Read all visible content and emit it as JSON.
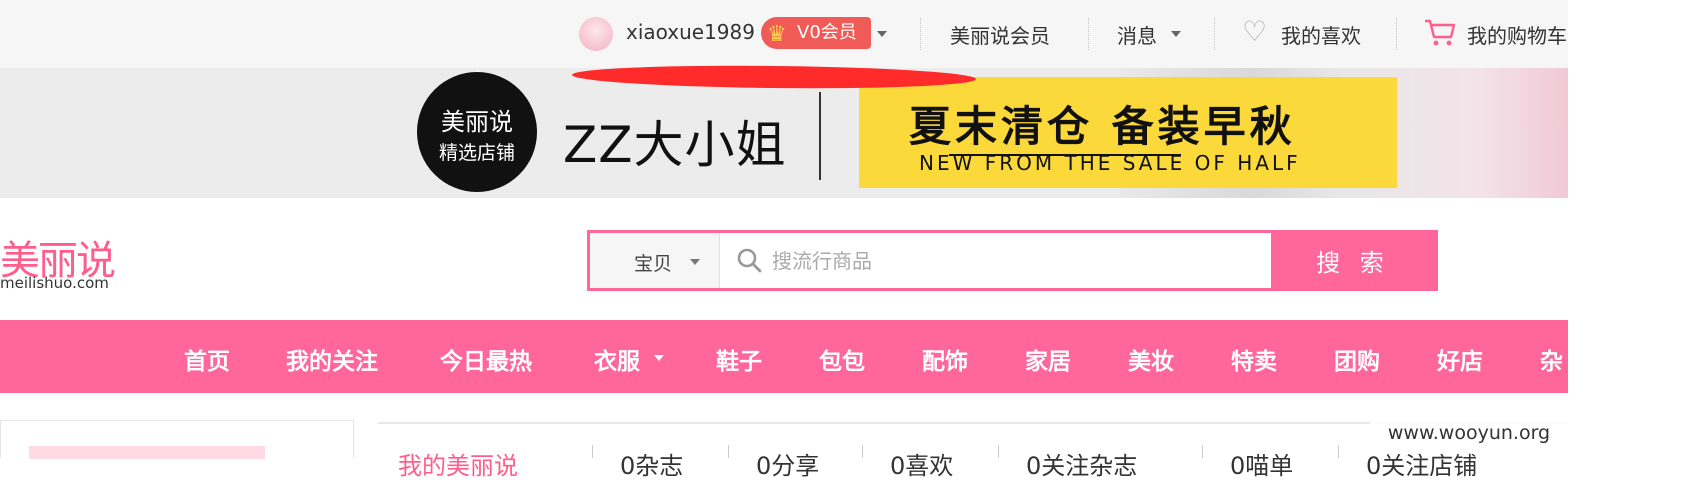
{
  "topbar": {
    "username": "xiaoxue1989",
    "vip_label": "V0会员",
    "links": {
      "member": "美丽说会员",
      "messages": "消息",
      "favorites": "我的喜欢",
      "cart": "我的购物车"
    }
  },
  "banner": {
    "badge_line1": "美丽说",
    "badge_line2": "精选店铺",
    "shop_name": "ZZ大小姐",
    "promo_title": "夏末清仓 备装早秋",
    "promo_subtitle": "NEW FROM THE SALE OF HALF"
  },
  "header": {
    "logo_cn": "美丽说",
    "logo_en": "meilishuo.com",
    "search": {
      "scope": "宝贝",
      "placeholder": "搜流行商品",
      "button": "搜 索"
    }
  },
  "nav": {
    "items": [
      "首页",
      "我的关注",
      "今日最热",
      "衣服",
      "鞋子",
      "包包",
      "配饰",
      "家居",
      "美妆",
      "特卖",
      "团购",
      "好店",
      "杂"
    ]
  },
  "subtabs": [
    "我的美丽说",
    "0杂志",
    "0分享",
    "0喜欢",
    "0关注杂志",
    "0喵单",
    "0关注店铺"
  ],
  "watermark": "www.wooyun.org",
  "colors": {
    "brand_pink": "#ff6699",
    "vip_red": "#f05a57",
    "promo_yellow": "#fcd93a",
    "annotation_red": "#ff2a2a"
  }
}
